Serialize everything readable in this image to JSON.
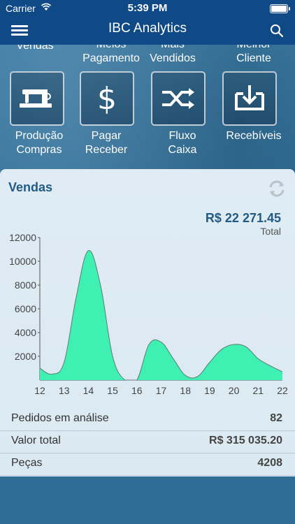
{
  "status": {
    "carrier": "Carrier",
    "time": "5:39 PM"
  },
  "navbar": {
    "title": "IBC Analytics",
    "menu_icon": "hamburger-icon",
    "search_icon": "search-icon"
  },
  "top_labels": [
    {
      "text": "Vendas"
    },
    {
      "text": "Meios\nPagamento"
    },
    {
      "text": "Mais\nVendidos"
    },
    {
      "text": "Melhor\nCliente"
    }
  ],
  "tiles": [
    {
      "label_line1": "Produção",
      "label_line2": "Compras",
      "icon": "sewing-machine-icon"
    },
    {
      "label_line1": "Pagar",
      "label_line2": "Receber",
      "icon": "dollar-icon"
    },
    {
      "label_line1": "Fluxo",
      "label_line2": "Caixa",
      "icon": "shuffle-icon"
    },
    {
      "label_line1": "Recebíveis",
      "label_line2": "",
      "icon": "download-box-icon"
    }
  ],
  "card": {
    "title": "Vendas",
    "total_value": "R$ 22 271.45",
    "total_label": "Total",
    "refresh_icon": "refresh-icon"
  },
  "chart_data": {
    "type": "area",
    "x": [
      12,
      12.5,
      13,
      13.5,
      14,
      14.5,
      15,
      15.5,
      16,
      16.5,
      17,
      17.5,
      18,
      18.5,
      19,
      19.5,
      20,
      20.5,
      21,
      21.5,
      22
    ],
    "y": [
      1000,
      500,
      1500,
      7000,
      10900,
      8000,
      2000,
      0,
      0,
      3000,
      3200,
      1800,
      400,
      300,
      1500,
      2600,
      3000,
      2800,
      1800,
      1200,
      700
    ],
    "xticks": [
      "12",
      "13",
      "14",
      "15",
      "16",
      "17",
      "18",
      "19",
      "20",
      "21",
      "22"
    ],
    "yticks": [
      "2000",
      "4000",
      "6000",
      "8000",
      "10000",
      "12000"
    ],
    "ylim": [
      0,
      12000
    ],
    "xlim": [
      12,
      22
    ],
    "fill_color": "#3ff0b3",
    "line_color": "#5f7b72"
  },
  "summary": [
    {
      "label": "Pedidos em análise",
      "value": "82"
    },
    {
      "label": "Valor total",
      "value": "R$ 315 035.20"
    },
    {
      "label": "Peças",
      "value": "4208"
    }
  ]
}
